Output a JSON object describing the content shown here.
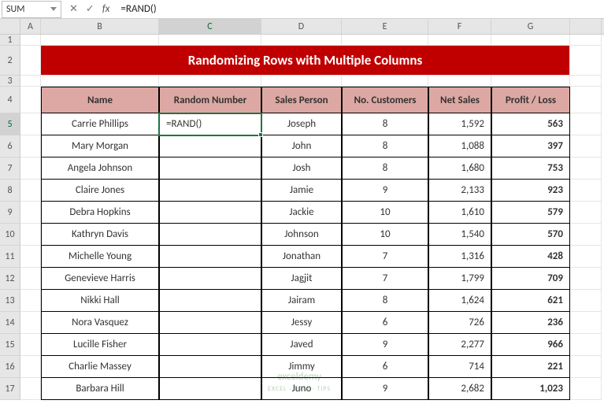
{
  "name_box": "SUM",
  "formula_bar": "=RAND()",
  "columns": [
    "A",
    "B",
    "C",
    "D",
    "E",
    "F",
    "G"
  ],
  "active_col": "C",
  "active_row": 5,
  "title": "Randomizing Rows with Multiple Columns",
  "headers": {
    "name": "Name",
    "rand": "Random Number",
    "sales": "Sales Person",
    "cust": "No. Customers",
    "net": "Net Sales",
    "pl": "Profit / Loss"
  },
  "editing_value": "=RAND()",
  "rows": [
    {
      "r": 5,
      "name": "Carrie Phillips",
      "rand": "",
      "sales": "Joseph",
      "cust": "8",
      "net": "1,592",
      "pl": "563"
    },
    {
      "r": 6,
      "name": "Mary Morgan",
      "rand": "",
      "sales": "John",
      "cust": "8",
      "net": "1,088",
      "pl": "397"
    },
    {
      "r": 7,
      "name": "Angela Johnson",
      "rand": "",
      "sales": "Josh",
      "cust": "8",
      "net": "1,680",
      "pl": "753"
    },
    {
      "r": 8,
      "name": "Claire Jones",
      "rand": "",
      "sales": "Jamie",
      "cust": "9",
      "net": "2,133",
      "pl": "923"
    },
    {
      "r": 9,
      "name": "Debra Hopkins",
      "rand": "",
      "sales": "Jackie",
      "cust": "10",
      "net": "1,610",
      "pl": "579"
    },
    {
      "r": 10,
      "name": "Kathryn Davis",
      "rand": "",
      "sales": "Johnson",
      "cust": "10",
      "net": "1,540",
      "pl": "570"
    },
    {
      "r": 11,
      "name": "Michelle Young",
      "rand": "",
      "sales": "Jonathan",
      "cust": "7",
      "net": "1,316",
      "pl": "428"
    },
    {
      "r": 12,
      "name": "Genevieve Harris",
      "rand": "",
      "sales": "Jagjit",
      "cust": "7",
      "net": "1,799",
      "pl": "709"
    },
    {
      "r": 13,
      "name": "Nikki Hall",
      "rand": "",
      "sales": "Jairam",
      "cust": "8",
      "net": "1,624",
      "pl": "621"
    },
    {
      "r": 14,
      "name": "Nora Vasquez",
      "rand": "",
      "sales": "Jessy",
      "cust": "6",
      "net": "726",
      "pl": "236"
    },
    {
      "r": 15,
      "name": "Lucille Fisher",
      "rand": "",
      "sales": "Javed",
      "cust": "9",
      "net": "2,277",
      "pl": "966"
    },
    {
      "r": 16,
      "name": "Charlie Massey",
      "rand": "",
      "sales": "Jimmy",
      "cust": "6",
      "net": "714",
      "pl": "221"
    },
    {
      "r": 17,
      "name": "Barbara Hill",
      "rand": "",
      "sales": "Juno",
      "cust": "9",
      "net": "2,682",
      "pl": "1,023"
    }
  ],
  "watermark": {
    "main": "exceldemy",
    "sub": "EXCEL · DATA · TIPS"
  }
}
